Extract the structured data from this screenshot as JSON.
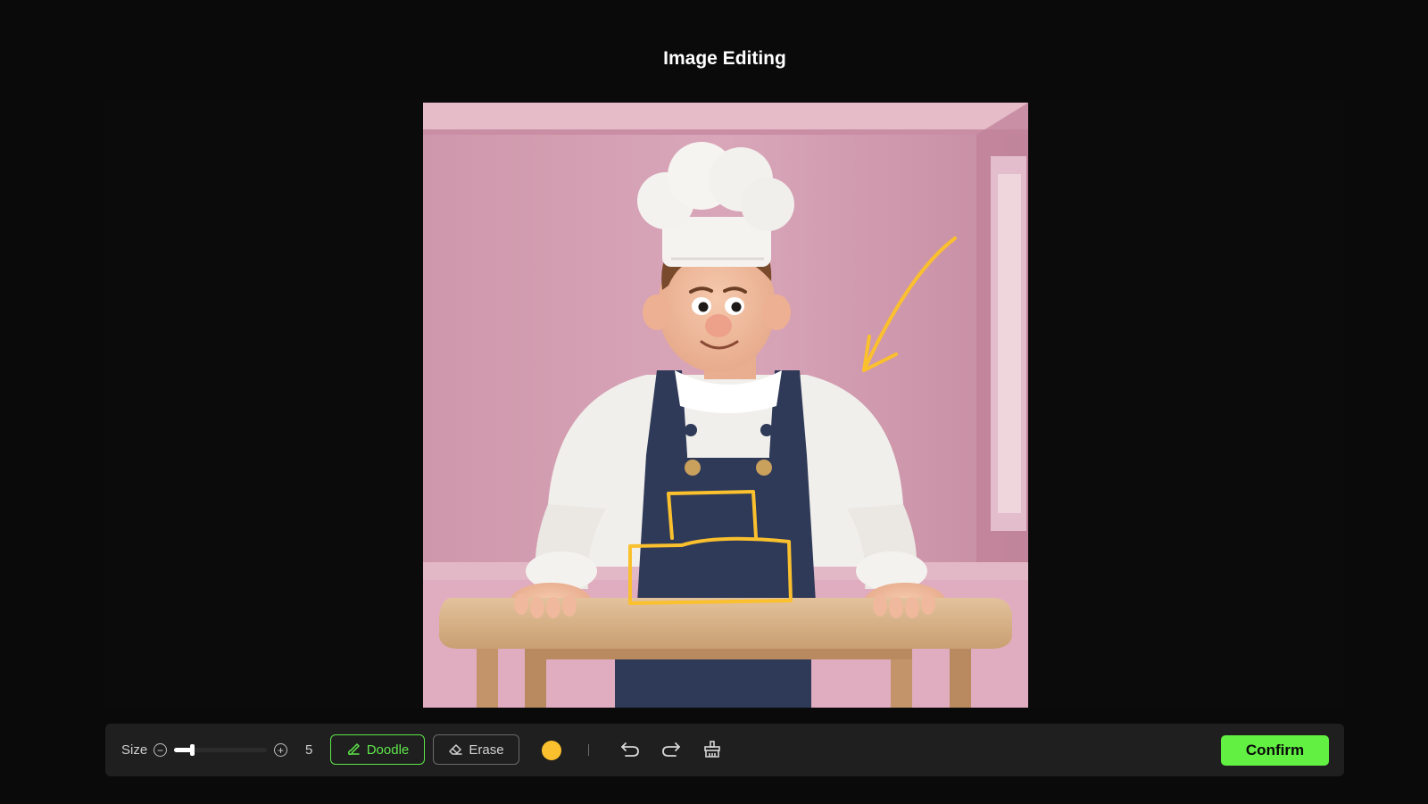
{
  "page": {
    "title": "Image Editing"
  },
  "toolbar": {
    "size_label": "Size",
    "size_value": "5",
    "size_fraction": 0.2,
    "doodle_label": "Doodle",
    "erase_label": "Erase",
    "active_tool": "Doodle",
    "brush_color": "#fbc02d",
    "confirm_label": "Confirm"
  },
  "colors": {
    "accent": "#5ee64a",
    "confirm_bg": "#62f043",
    "doodle_stroke": "#fbc02d"
  },
  "icons": {
    "minus": "minus-circle-icon",
    "plus": "plus-circle-icon",
    "doodle": "brush-icon",
    "erase": "eraser-icon",
    "undo": "undo-icon",
    "redo": "redo-icon",
    "clear": "broom-icon"
  }
}
